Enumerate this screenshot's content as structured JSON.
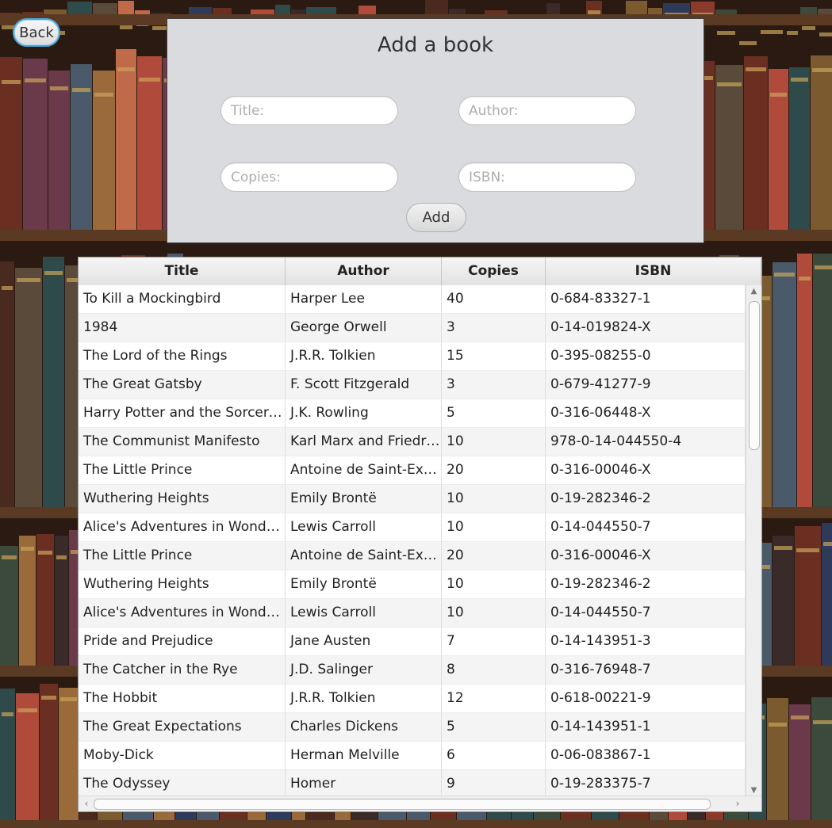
{
  "back_button": {
    "label": "Back"
  },
  "form": {
    "title": "Add a book",
    "fields": {
      "title_placeholder": "Title:",
      "author_placeholder": "Author:",
      "copies_placeholder": "Copies:",
      "isbn_placeholder": "ISBN:"
    },
    "add_label": "Add"
  },
  "table": {
    "headers": [
      "Title",
      "Author",
      "Copies",
      "ISBN"
    ],
    "rows": [
      [
        "To Kill a Mockingbird",
        "Harper Lee",
        "40",
        "0-684-83327-1"
      ],
      [
        "1984",
        "George Orwell",
        "3",
        "0-14-019824-X"
      ],
      [
        "The Lord of the Rings",
        "J.R.R. Tolkien",
        "15",
        "0-395-08255-0"
      ],
      [
        "The Great Gatsby",
        "F. Scott Fitzgerald",
        "3",
        "0-679-41277-9"
      ],
      [
        "Harry Potter and the Sorcerer...",
        "J.K. Rowling",
        "5",
        "0-316-06448-X"
      ],
      [
        "The Communist Manifesto",
        "Karl Marx and Friedri...",
        "10",
        "978-0-14-044550-4"
      ],
      [
        "The Little Prince",
        "Antoine de Saint-Exu...",
        "20",
        "0-316-00046-X"
      ],
      [
        "Wuthering Heights",
        "Emily Brontë",
        "10",
        "0-19-282346-2"
      ],
      [
        "Alice's Adventures in Wonder...",
        "Lewis Carroll",
        "10",
        "0-14-044550-7"
      ],
      [
        "The Little Prince",
        "Antoine de Saint-Exu...",
        "20",
        "0-316-00046-X"
      ],
      [
        "Wuthering Heights",
        "Emily Brontë",
        "10",
        "0-19-282346-2"
      ],
      [
        "Alice's Adventures in Wonder...",
        "Lewis Carroll",
        "10",
        "0-14-044550-7"
      ],
      [
        "Pride and Prejudice",
        "Jane Austen",
        "7",
        "0-14-143951-3"
      ],
      [
        "The Catcher in the Rye",
        "J.D. Salinger",
        "8",
        "0-316-76948-7"
      ],
      [
        "The Hobbit",
        "J.R.R. Tolkien",
        "12",
        "0-618-00221-9"
      ],
      [
        "The Great Expectations",
        "Charles Dickens",
        "5",
        "0-14-143951-1"
      ],
      [
        "Moby-Dick",
        "Herman Melville",
        "6",
        "0-06-083867-1"
      ],
      [
        "The Odyssey",
        "Homer",
        "9",
        "0-19-283375-7"
      ]
    ]
  },
  "colors": {
    "accent_focus": "#4aa8e0",
    "panel_bg": "#dadbde",
    "shelf_dark": "#2a1a12"
  }
}
